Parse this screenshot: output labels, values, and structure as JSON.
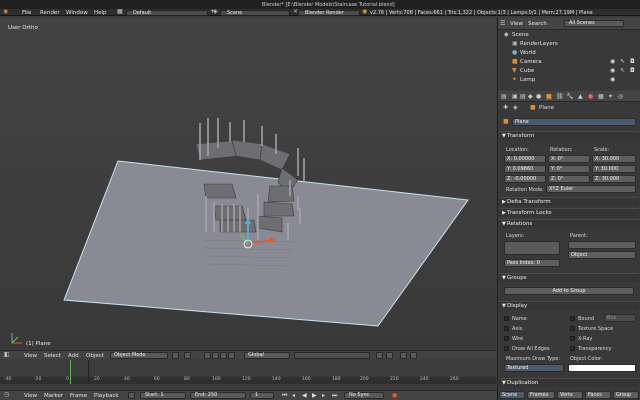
{
  "topbar": {
    "title": "Blender* [E:\\Blender Models\\Staircase Tutorial.blend]",
    "menus": [
      "File",
      "Render",
      "Window",
      "Help"
    ],
    "layout": "Default",
    "scene": "Scene",
    "engine": "Blender Render",
    "stats": "v2.76 | Verts:708 | Faces:661 | Tris:1,322 | Objects:1/3 | Lamps:0/1 | Mem:27.19M | Plane"
  },
  "viewport": {
    "view_label": "User Ortho",
    "object_label": "(1) Plane",
    "colors": {
      "plane": "#8a8a95",
      "plane_edge": "#c7e5ef",
      "stairs": "#6e6e72"
    }
  },
  "view3d_header": {
    "items": [
      "View",
      "Select",
      "Add",
      "Object"
    ],
    "mode": "Object Mode",
    "orientation": "Global"
  },
  "timeline": {
    "ticks": [
      "-40",
      "-20",
      "0",
      "20",
      "40",
      "60",
      "80",
      "100",
      "120",
      "140",
      "160",
      "180",
      "200",
      "220",
      "240",
      "260"
    ],
    "items": [
      "View",
      "Marker",
      "Frame",
      "Playback"
    ],
    "start_label": "Start:",
    "start": "1",
    "end_label": "End:",
    "end": "250",
    "current": "1",
    "sync": "No Sync"
  },
  "outliner": {
    "menu": [
      "View",
      "Search"
    ],
    "filter": "All Scenes",
    "rows": [
      "Scene",
      "RenderLayers",
      "World",
      "Camera",
      "Cube",
      "Lamp"
    ]
  },
  "properties": {
    "object_name": "Plane",
    "datablock": "Plane",
    "transform": {
      "title": "Transform",
      "location_label": "Location:",
      "rotation_label": "Rotation:",
      "scale_label": "Scale:",
      "location": [
        "X: 0.00000",
        "Y: 0.09860",
        "Z: -0.00000"
      ],
      "rotation": [
        "X: 0°",
        "Y: 0°",
        "Z: 0°"
      ],
      "scale": [
        "X: 30.000",
        "Y: 30.000",
        "Z: 30.000"
      ],
      "rotation_mode_label": "Rotation Mode:",
      "rotation_mode": "XYZ Euler"
    },
    "delta_transform": "Delta Transform",
    "transform_locks": "Transform Locks",
    "relations": {
      "title": "Relations",
      "layers_label": "Layers:",
      "parent_label": "Parent:",
      "parent_type": "Object",
      "pass_index_label": "Pass Index:",
      "pass_index": "0"
    },
    "groups": {
      "title": "Groups",
      "add_button": "Add to Group"
    },
    "display": {
      "title": "Display",
      "left": [
        "Name",
        "Axis",
        "Wire",
        "Draw All Edges"
      ],
      "right": [
        "Bound",
        "Texture Space",
        "X-Ray",
        "Transparency"
      ],
      "bound_type": "Box",
      "max_draw_label": "Maximum Draw Type:",
      "max_draw": "Textured",
      "color_label": "Object Color:"
    },
    "duplication": "Duplication",
    "bottom_tabs": [
      "Scene",
      "Frames",
      "Verts",
      "Faces",
      "Group"
    ]
  }
}
